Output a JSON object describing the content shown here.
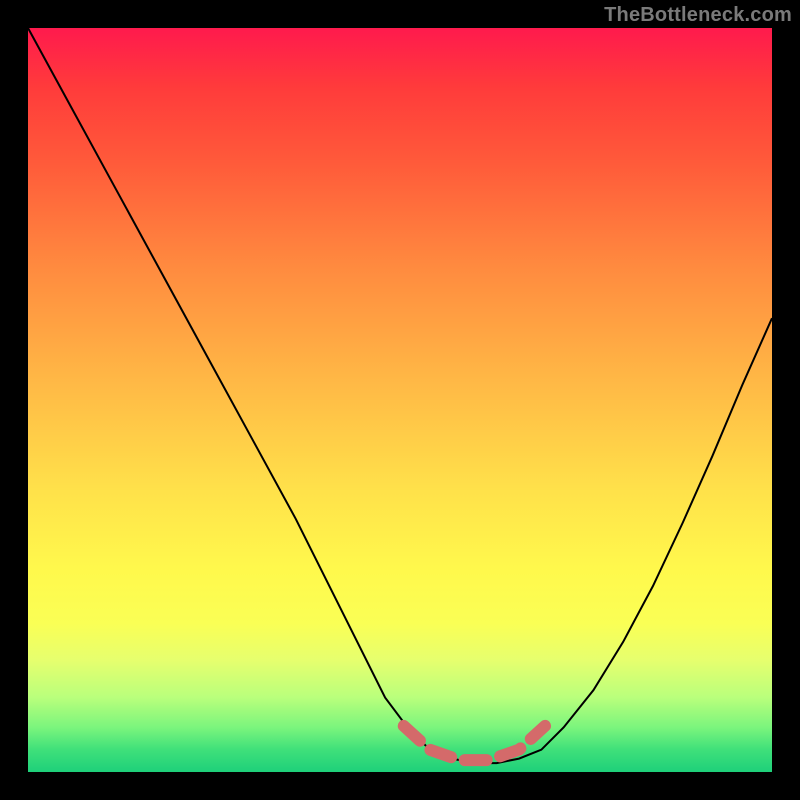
{
  "watermark": "TheBottleneck.com",
  "chart_data": {
    "type": "line",
    "title": "",
    "xlabel": "",
    "ylabel": "",
    "xlim": [
      0,
      1
    ],
    "ylim": [
      0,
      1
    ],
    "series": [
      {
        "name": "black-curve",
        "stroke": "#000000",
        "stroke_width": 2,
        "x": [
          0.0,
          0.06,
          0.12,
          0.18,
          0.24,
          0.3,
          0.36,
          0.42,
          0.48,
          0.51,
          0.54,
          0.57,
          0.6,
          0.63,
          0.66,
          0.69,
          0.72,
          0.76,
          0.8,
          0.84,
          0.88,
          0.92,
          0.96,
          1.0
        ],
        "y": [
          1.0,
          0.89,
          0.78,
          0.67,
          0.56,
          0.45,
          0.34,
          0.22,
          0.1,
          0.06,
          0.03,
          0.018,
          0.012,
          0.012,
          0.018,
          0.03,
          0.06,
          0.11,
          0.175,
          0.25,
          0.335,
          0.425,
          0.52,
          0.61
        ]
      },
      {
        "name": "red-band",
        "stroke": "#d46a6a",
        "stroke_width": 12,
        "linecap": "round",
        "dash": [
          22,
          14
        ],
        "x": [
          0.505,
          0.54,
          0.58,
          0.62,
          0.66,
          0.695
        ],
        "y": [
          0.062,
          0.03,
          0.016,
          0.016,
          0.03,
          0.062
        ]
      }
    ],
    "legend": null,
    "grid": false
  }
}
